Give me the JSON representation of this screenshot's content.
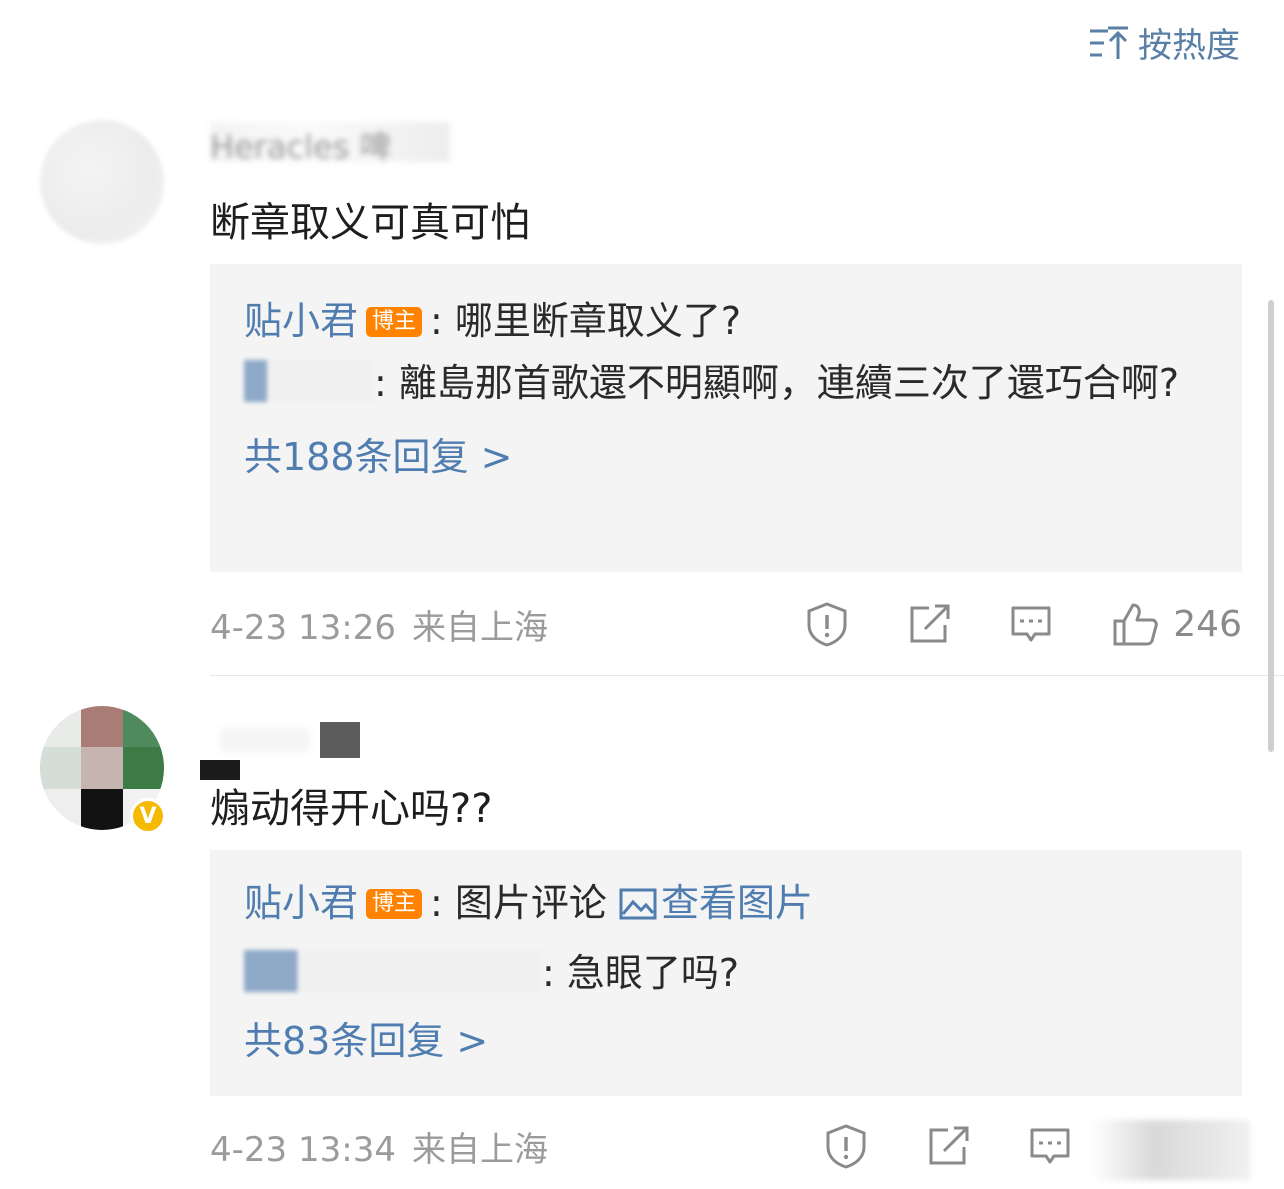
{
  "sort": {
    "label": "按热度",
    "icon": "sort-icon"
  },
  "comments": [
    {
      "username": "Heracles 啤",
      "text": "断章取义可真可怕",
      "replies": [
        {
          "name": "贴小君",
          "badge": "博主",
          "text": ": 哪里断章取义了?"
        },
        {
          "name": "",
          "text": ": 離島那首歌還不明顯啊，連續三次了還巧合啊?"
        }
      ],
      "more": "共188条回复 >",
      "time": "4-23 13:26",
      "location": "来自上海",
      "likes": "246"
    },
    {
      "username": "",
      "text": "煽动得开心吗??",
      "verified": "V",
      "replies": [
        {
          "name": "贴小君",
          "badge": "博主",
          "text": ": 图片评论",
          "link": "查看图片"
        },
        {
          "name": "",
          "text": ": 急眼了吗?"
        }
      ],
      "more": "共83条回复 >",
      "time": "4-23 13:34",
      "location": "来自上海",
      "likes": ""
    }
  ],
  "colors": {
    "link": "#4f7db0",
    "badge": "#ff8200",
    "meta": "#9b9b9b",
    "reply_bg": "#f4f4f4"
  }
}
